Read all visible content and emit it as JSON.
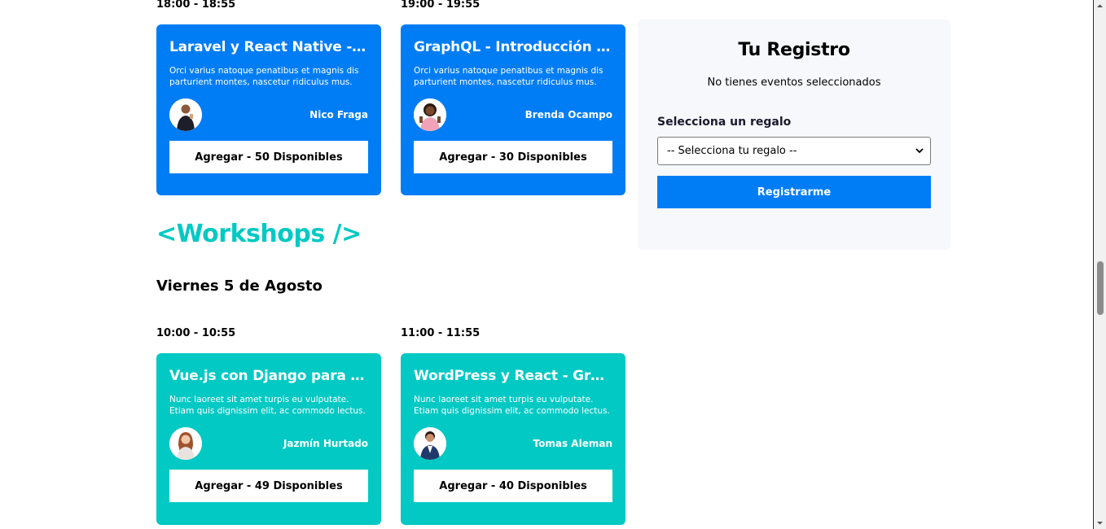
{
  "colors": {
    "conference_blue": "#007df4",
    "workshop_teal": "#02c9c3",
    "panel_bg": "#f6f8fb"
  },
  "conferences": [
    {
      "time": "18:00 - 18:55",
      "title": "Laravel y React Native - Fundamentos",
      "description": "Orci varius natoque penatibus et magnis dis parturient montes, nascetur ridiculus mus.",
      "speaker": "Nico Fraga",
      "button": "Agregar - 50 Disponibles",
      "avatar_icon": "speaker-avatar-icon"
    },
    {
      "time": "19:00 - 19:55",
      "title": "GraphQL - Introducción al lenguaje",
      "description": "Orci varius natoque penatibus et magnis dis parturient montes, nascetur ridiculus mus.",
      "speaker": "Brenda Ocampo",
      "button": "Agregar - 30 Disponibles",
      "avatar_icon": "speaker-avatar-icon"
    }
  ],
  "workshops_section": {
    "title": "<Workshops />",
    "day": "Viernes 5 de Agosto",
    "events": [
      {
        "time": "10:00 - 10:55",
        "title": "Vue.js con Django para principiantes",
        "description": "Nunc laoreet sit amet turpis eu vulputate. Etiam quis dignissim elit, ac commodo lectus.",
        "speaker": "Jazmín Hurtado",
        "button": "Agregar - 49 Disponibles",
        "avatar_icon": "speaker-avatar-icon"
      },
      {
        "time": "11:00 - 11:55",
        "title": "WordPress y React - Gran combinación",
        "description": "Nunc laoreet sit amet turpis eu vulputate. Etiam quis dignissim elit, ac commodo lectus.",
        "speaker": "Tomas Aleman",
        "button": "Agregar - 40 Disponibles",
        "avatar_icon": "speaker-avatar-icon"
      }
    ]
  },
  "registro": {
    "title": "Tu Registro",
    "empty_message": "No tienes eventos seleccionados",
    "gift_label": "Selecciona un regalo",
    "gift_select_value": "-- Selecciona tu regalo --",
    "submit_button": "Registrarme"
  }
}
